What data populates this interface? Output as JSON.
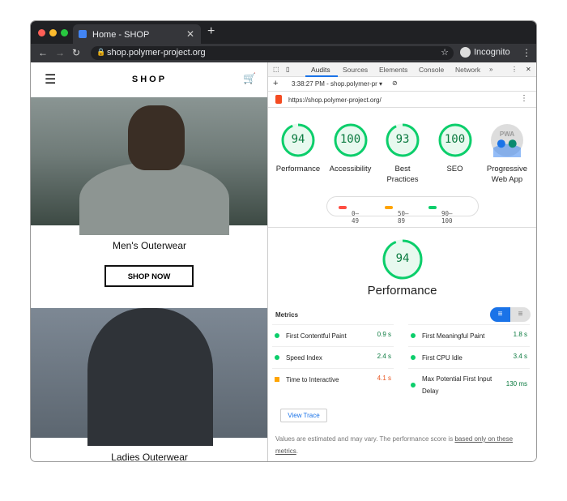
{
  "browser": {
    "tab_title": "Home - SHOP",
    "url": "shop.polymer-project.org",
    "incognito_label": "Incognito"
  },
  "shop": {
    "brand": "SHOP",
    "categories": [
      {
        "title": "Men's Outerwear",
        "button": "SHOP NOW"
      },
      {
        "title": "Ladies Outerwear"
      }
    ]
  },
  "devtools": {
    "tabs": [
      "Audits",
      "Sources",
      "Elements",
      "Console",
      "Network"
    ],
    "active_tab": "Audits",
    "more": "»",
    "report_selector": "3:38:27 PM - shop.polymer-pr",
    "report_url": "https://shop.polymer-project.org/",
    "scores": [
      {
        "label": "Performance",
        "score": "94"
      },
      {
        "label": "Accessibility",
        "score": "100"
      },
      {
        "label": "Best Practices",
        "score": "93"
      },
      {
        "label": "SEO",
        "score": "100"
      },
      {
        "label": "Progressive Web App",
        "score": "PWA"
      }
    ],
    "legend": [
      {
        "range": "0–49",
        "color": "#ff4e42"
      },
      {
        "range": "50–89",
        "color": "#ffa400"
      },
      {
        "range": "90–100",
        "color": "#0cce6b"
      }
    ],
    "section_score": "94",
    "section_title": "Performance",
    "metrics_title": "Metrics",
    "metrics": [
      {
        "name": "First Contentful Paint",
        "value": "0.9 s",
        "status": "pass"
      },
      {
        "name": "First Meaningful Paint",
        "value": "1.8 s",
        "status": "pass"
      },
      {
        "name": "Speed Index",
        "value": "2.4 s",
        "status": "pass"
      },
      {
        "name": "First CPU Idle",
        "value": "3.4 s",
        "status": "pass"
      },
      {
        "name": "Time to Interactive",
        "value": "4.1 s",
        "status": "average"
      },
      {
        "name": "Max Potential First Input Delay",
        "value": "130 ms",
        "status": "pass"
      }
    ],
    "view_trace": "View Trace",
    "footnote": "Values are estimated and may vary. The performance score is ",
    "footnote_link": "based only on these metrics",
    "footnote_end": "."
  }
}
